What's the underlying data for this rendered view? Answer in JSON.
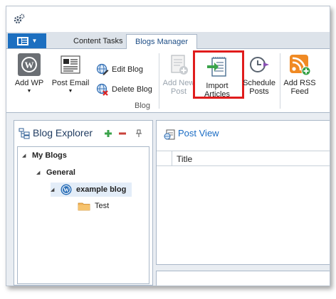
{
  "tabs": {
    "content_tasks": "Content Tasks",
    "blogs_manager": "Blogs Manager"
  },
  "ribbon": {
    "add_wp": "Add WP",
    "post_email": "Post Email",
    "edit_blog": "Edit Blog",
    "delete_blog": "Delete Blog",
    "add_new_post": "Add New\nPost",
    "import_articles": "Import\nArticles",
    "schedule_posts": "Schedule\nPosts",
    "add_rss_feed": "Add RSS\nFeed",
    "group_label": "Blog"
  },
  "blog_explorer": {
    "title": "Blog Explorer",
    "tree": {
      "root": "My Blogs",
      "group": "General",
      "blog": "example blog",
      "folder": "Test"
    }
  },
  "post_view": {
    "title": "Post View",
    "columns": [
      "Title"
    ]
  },
  "colors": {
    "accent_blue": "#1c6fc0",
    "highlight_red": "#e01c1c",
    "add_green": "#3aa34a",
    "remove_red": "#c9423a"
  }
}
